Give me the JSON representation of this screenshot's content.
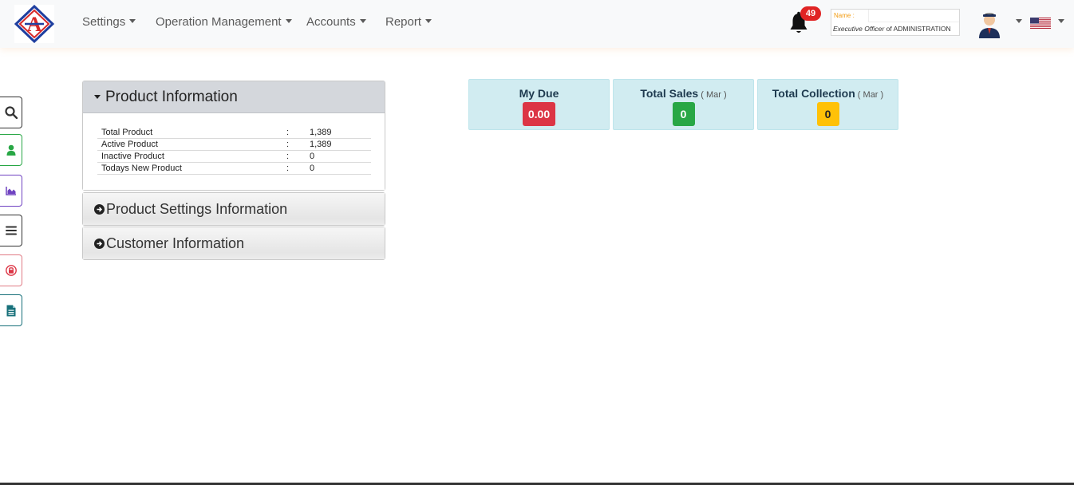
{
  "nav": {
    "menu": [
      {
        "label": "Settings"
      },
      {
        "label": "Operation Management"
      },
      {
        "label": "Accounts"
      },
      {
        "label": "Report"
      }
    ],
    "notification_count": "49",
    "user": {
      "name_label": "Name :",
      "title_prefix": "Executive Officer",
      "title_of": " of ",
      "title_dept": "ADMINISTRATION"
    },
    "icons": [
      "logo",
      "bell-icon",
      "avatar",
      "us-flag-icon"
    ]
  },
  "sidebar": {
    "buttons": [
      {
        "name": "search",
        "color": "#333333"
      },
      {
        "name": "user",
        "color": "#28a745"
      },
      {
        "name": "area-chart",
        "color": "#6f42c1"
      },
      {
        "name": "menu",
        "color": "#333333"
      },
      {
        "name": "lock",
        "color": "#dc3545"
      },
      {
        "name": "document",
        "color": "#17707a"
      }
    ]
  },
  "product_info": {
    "title": "Product Information",
    "rows": [
      {
        "label": "Total Product",
        "colon": ":",
        "value": "1,389"
      },
      {
        "label": "Active Product",
        "colon": ":",
        "value": "1,389"
      },
      {
        "label": "Inactive Product",
        "colon": ":",
        "value": "0"
      },
      {
        "label": "Todays New Product",
        "colon": ":",
        "value": "0"
      }
    ]
  },
  "collapsed_panels": [
    {
      "title": "Product Settings Information"
    },
    {
      "title": "Customer Information"
    }
  ],
  "cards": [
    {
      "title": "My Due",
      "sub": "",
      "value": "0.00",
      "color": "#dc3545"
    },
    {
      "title": "Total Sales",
      "sub": " ( Mar )",
      "value": "0",
      "color": "#28a745"
    },
    {
      "title": "Total Collection",
      "sub": " ( Mar )",
      "value": "0",
      "color": "#ffc107"
    }
  ]
}
